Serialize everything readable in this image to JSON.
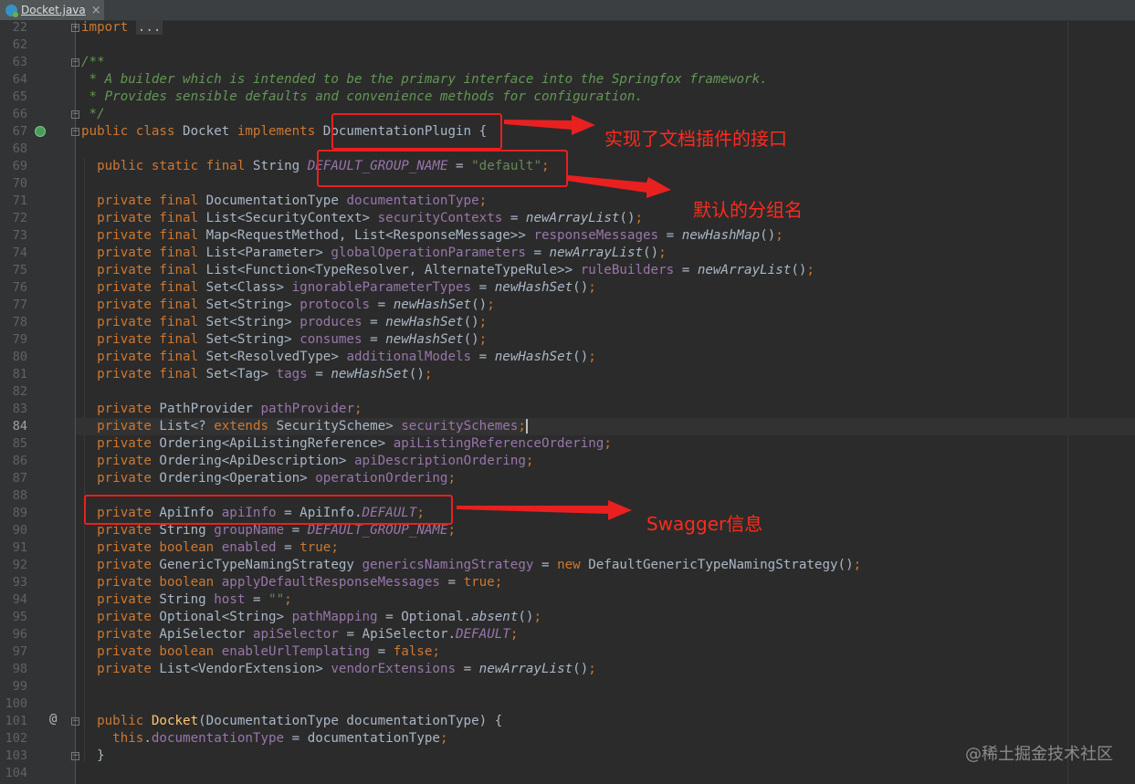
{
  "tab": {
    "label": "Docket.java",
    "close": "×"
  },
  "lines": [
    {
      "n": "22",
      "html": "<span class=\"kw\">import</span> <span class=\"fold\">...</span>"
    },
    {
      "n": "62",
      "html": ""
    },
    {
      "n": "63",
      "html": "<span class=\"doc\">/**</span>"
    },
    {
      "n": "64",
      "html": "<span class=\"doc\"> * A builder which is intended to be the primary interface into the Springfox framework.</span>"
    },
    {
      "n": "65",
      "html": "<span class=\"doc\"> * Provides sensible defaults and convenience methods for configuration.</span>"
    },
    {
      "n": "66",
      "html": "<span class=\"doc\"> */</span>"
    },
    {
      "n": "67",
      "html": "<span class=\"kw\">public class</span> Docket <span class=\"kw\">implements</span> DocumentationPlugin {"
    },
    {
      "n": "68",
      "html": ""
    },
    {
      "n": "69",
      "html": "  <span class=\"kw\">public static final</span> String <span class=\"cst\">DEFAULT_GROUP_NAME</span> = <span class=\"str\">\"default\"</span><span class=\"kw\">;</span>"
    },
    {
      "n": "70",
      "html": ""
    },
    {
      "n": "71",
      "html": "  <span class=\"kw\">private final</span> DocumentationType <span class=\"fld\">documentationType</span><span class=\"kw\">;</span>"
    },
    {
      "n": "72",
      "html": "  <span class=\"kw\">private final</span> List&lt;SecurityContext&gt; <span class=\"fld\">securityContexts</span> = <span class=\"sm\">newArrayList</span>()<span class=\"kw\">;</span>"
    },
    {
      "n": "73",
      "html": "  <span class=\"kw\">private final</span> Map&lt;RequestMethod, List&lt;ResponseMessage&gt;&gt; <span class=\"fld\">responseMessages</span> = <span class=\"sm\">newHashMap</span>()<span class=\"kw\">;</span>"
    },
    {
      "n": "74",
      "html": "  <span class=\"kw\">private final</span> List&lt;Parameter&gt; <span class=\"fld\">globalOperationParameters</span> = <span class=\"sm\">newArrayList</span>()<span class=\"kw\">;</span>"
    },
    {
      "n": "75",
      "html": "  <span class=\"kw\">private final</span> List&lt;Function&lt;TypeResolver, AlternateTypeRule&gt;&gt; <span class=\"fld\">ruleBuilders</span> = <span class=\"sm\">newArrayList</span>()<span class=\"kw\">;</span>"
    },
    {
      "n": "76",
      "html": "  <span class=\"kw\">private final</span> Set&lt;Class&gt; <span class=\"fld\">ignorableParameterTypes</span> = <span class=\"sm\">newHashSet</span>()<span class=\"kw\">;</span>"
    },
    {
      "n": "77",
      "html": "  <span class=\"kw\">private final</span> Set&lt;String&gt; <span class=\"fld\">protocols</span> = <span class=\"sm\">newHashSet</span>()<span class=\"kw\">;</span>"
    },
    {
      "n": "78",
      "html": "  <span class=\"kw\">private final</span> Set&lt;String&gt; <span class=\"fld\">produces</span> = <span class=\"sm\">newHashSet</span>()<span class=\"kw\">;</span>"
    },
    {
      "n": "79",
      "html": "  <span class=\"kw\">private final</span> Set&lt;String&gt; <span class=\"fld\">consumes</span> = <span class=\"sm\">newHashSet</span>()<span class=\"kw\">;</span>"
    },
    {
      "n": "80",
      "html": "  <span class=\"kw\">private final</span> Set&lt;ResolvedType&gt; <span class=\"fld\">additionalModels</span> = <span class=\"sm\">newHashSet</span>()<span class=\"kw\">;</span>"
    },
    {
      "n": "81",
      "html": "  <span class=\"kw\">private final</span> Set&lt;Tag&gt; <span class=\"fld\">tags</span> = <span class=\"sm\">newHashSet</span>()<span class=\"kw\">;</span>"
    },
    {
      "n": "82",
      "html": ""
    },
    {
      "n": "83",
      "html": "  <span class=\"kw\">private</span> PathProvider <span class=\"fld\">pathProvider</span><span class=\"kw\">;</span>"
    },
    {
      "n": "84",
      "html": "  <span class=\"kw\">private</span> List&lt;? <span class=\"kw\">extends</span> SecurityScheme&gt; <span class=\"fld\">securitySchemes</span><span class=\"kw cursor\">;</span>",
      "active": true
    },
    {
      "n": "85",
      "html": "  <span class=\"kw\">private</span> Ordering&lt;ApiListingReference&gt; <span class=\"fld\">apiListingReferenceOrdering</span><span class=\"kw\">;</span>"
    },
    {
      "n": "86",
      "html": "  <span class=\"kw\">private</span> Ordering&lt;ApiDescription&gt; <span class=\"fld\">apiDescriptionOrdering</span><span class=\"kw\">;</span>"
    },
    {
      "n": "87",
      "html": "  <span class=\"kw\">private</span> Ordering&lt;Operation&gt; <span class=\"fld\">operationOrdering</span><span class=\"kw\">;</span>"
    },
    {
      "n": "88",
      "html": ""
    },
    {
      "n": "89",
      "html": "  <span class=\"kw\">private</span> ApiInfo <span class=\"fld\">apiInfo</span> = ApiInfo.<span class=\"cst\">DEFAULT</span><span class=\"kw\">;</span>"
    },
    {
      "n": "90",
      "html": "  <span class=\"kw\">private</span> String <span class=\"fld\">groupName</span> = <span class=\"cst\">DEFAULT_GROUP_NAME</span><span class=\"kw\">;</span>"
    },
    {
      "n": "91",
      "html": "  <span class=\"kw\">private boolean</span> <span class=\"fld\">enabled</span> = <span class=\"kw\">true;</span>"
    },
    {
      "n": "92",
      "html": "  <span class=\"kw\">private</span> GenericTypeNamingStrategy <span class=\"fld\">genericsNamingStrategy</span> = <span class=\"kw\">new</span> DefaultGenericTypeNamingStrategy()<span class=\"kw\">;</span>"
    },
    {
      "n": "93",
      "html": "  <span class=\"kw\">private boolean</span> <span class=\"fld\">applyDefaultResponseMessages</span> = <span class=\"kw\">true;</span>"
    },
    {
      "n": "94",
      "html": "  <span class=\"kw\">private</span> String <span class=\"fld\">host</span> = <span class=\"str\">\"\"</span><span class=\"kw\">;</span>"
    },
    {
      "n": "95",
      "html": "  <span class=\"kw\">private</span> Optional&lt;String&gt; <span class=\"fld\">pathMapping</span> = Optional.<span class=\"sm\">absent</span>()<span class=\"kw\">;</span>"
    },
    {
      "n": "96",
      "html": "  <span class=\"kw\">private</span> ApiSelector <span class=\"fld\">apiSelector</span> = ApiSelector.<span class=\"cst\">DEFAULT</span><span class=\"kw\">;</span>"
    },
    {
      "n": "97",
      "html": "  <span class=\"kw\">private boolean</span> <span class=\"fld\">enableUrlTemplating</span> = <span class=\"kw\">false;</span>"
    },
    {
      "n": "98",
      "html": "  <span class=\"kw\">private</span> List&lt;VendorExtension&gt; <span class=\"fld\">vendorExtensions</span> = <span class=\"sm\">newArrayList</span>()<span class=\"kw\">;</span>"
    },
    {
      "n": "99",
      "html": ""
    },
    {
      "n": "100",
      "html": ""
    },
    {
      "n": "101",
      "html": "  <span class=\"kw\">public</span> <span class=\"fn\">Docket</span>(DocumentationType documentationType) {"
    },
    {
      "n": "102",
      "html": "    <span class=\"kw\">this</span>.<span class=\"fld\">documentationType</span> = documentationType<span class=\"kw\">;</span>"
    },
    {
      "n": "103",
      "html": "  }"
    },
    {
      "n": "104",
      "html": ""
    }
  ],
  "annotations": {
    "plugin_note": "实现了文档插件的接口",
    "group_note": "默认的分组名",
    "swagger_note": "Swagger信息"
  },
  "watermark": "@稀土掘金技术社区",
  "colors": {
    "background": "#2b2b2b",
    "keyword": "#cc7832",
    "field": "#9876aa",
    "string": "#6a8759",
    "doc_comment": "#629755",
    "method_decl": "#ffc66d",
    "annotation_red": "#e82020"
  }
}
